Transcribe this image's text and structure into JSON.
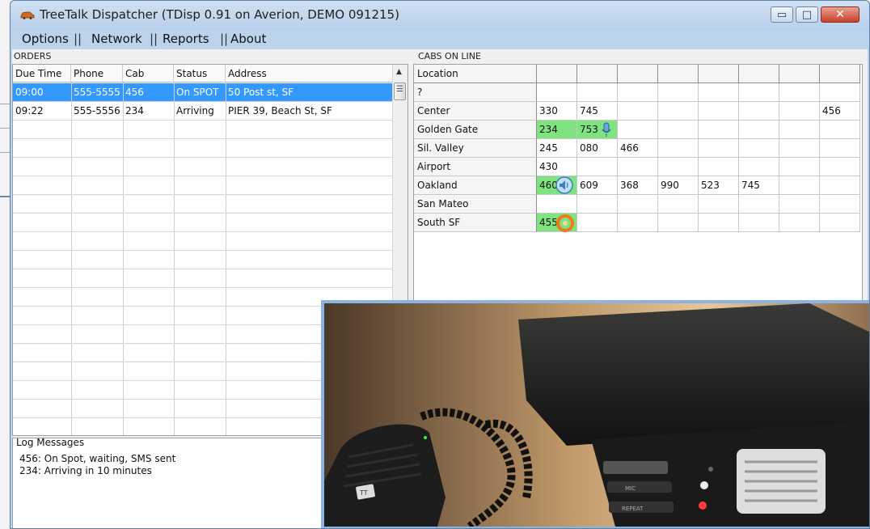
{
  "window": {
    "title": "TreeTalk Dispatcher (TDisp 0.91 on Averion, DEMO 091215)",
    "min_glyph": "▭",
    "max_glyph": "□",
    "close_glyph": "✕"
  },
  "menu": {
    "options": "Options",
    "network": "Network",
    "reports": "Reports",
    "about": "About",
    "separator": "||"
  },
  "orders": {
    "label": "ORDERS",
    "columns": [
      "Due Time",
      "Phone",
      "Cab",
      "Status",
      "Address"
    ],
    "rows": [
      {
        "due": "09:00",
        "phone": "555-5555",
        "cab": "456",
        "status": "On SPOT",
        "address": "50 Post st, SF"
      },
      {
        "due": "09:22",
        "phone": "555-5556",
        "cab": "234",
        "status": "Arriving",
        "address": "PIER 39, Beach St, SF"
      }
    ],
    "selected_row": 0,
    "colors": {
      "selected": "#3399ff"
    }
  },
  "log": {
    "title": "Log Messages",
    "lines": [
      "456: On Spot, waiting, SMS sent",
      "234: Arriving in 10 minutes"
    ]
  },
  "cabs": {
    "label": "CABS ON LINE",
    "header": "Location",
    "locations": [
      {
        "name": "?",
        "cabs": []
      },
      {
        "name": "Center",
        "cabs": [
          "330",
          "745",
          "",
          "",
          "",
          "",
          "",
          "456"
        ]
      },
      {
        "name": "Golden Gate",
        "cabs": [
          "234",
          "753"
        ],
        "green": [
          0,
          1
        ],
        "icon_after": 1,
        "icon": "microphone-icon"
      },
      {
        "name": "Sil. Valley",
        "cabs": [
          "245",
          "080",
          "466"
        ]
      },
      {
        "name": "Airport",
        "cabs": [
          "430"
        ]
      },
      {
        "name": "Oakland",
        "cabs": [
          "460",
          "609",
          "368",
          "990",
          "523",
          "745"
        ],
        "green": [
          0
        ],
        "icon_after": 0,
        "icon": "speaker-icon"
      },
      {
        "name": "San Mateo",
        "cabs": []
      },
      {
        "name": "South SF",
        "cabs": [
          "455"
        ],
        "green": [
          0
        ],
        "icon_after": 0,
        "icon": "ring-icon"
      }
    ],
    "colors": {
      "green": "#7fe37f"
    }
  },
  "photo": {
    "radio_labels": [
      "MIC",
      "REPEAT"
    ],
    "mic_logo": "TT"
  }
}
